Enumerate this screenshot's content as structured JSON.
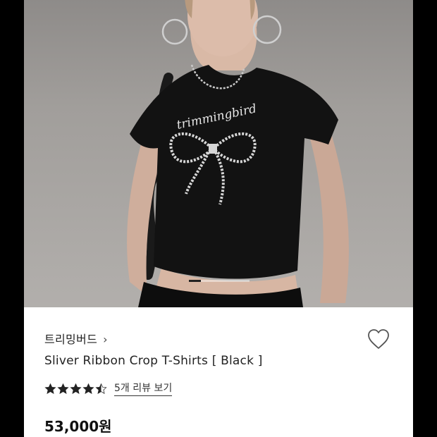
{
  "product": {
    "brand": "트리밍버드",
    "brand_chevron": "›",
    "name": "Sliver Ribbon Crop T-Shirts [ Black ]",
    "rating": 4.5,
    "rating_max": 5,
    "review_link": "5개 리뷰 보기",
    "price": "53,000원",
    "favorited": false,
    "print_text": "trimmingbird"
  },
  "gallery": {
    "progress": 0.2
  },
  "icons": {
    "favorite": "heart-outline-icon",
    "star": "star-icon",
    "brand_link": "chevron-right-icon"
  },
  "colors": {
    "background": "#000000",
    "card": "#ffffff",
    "text": "#222222",
    "star": "#222222"
  }
}
